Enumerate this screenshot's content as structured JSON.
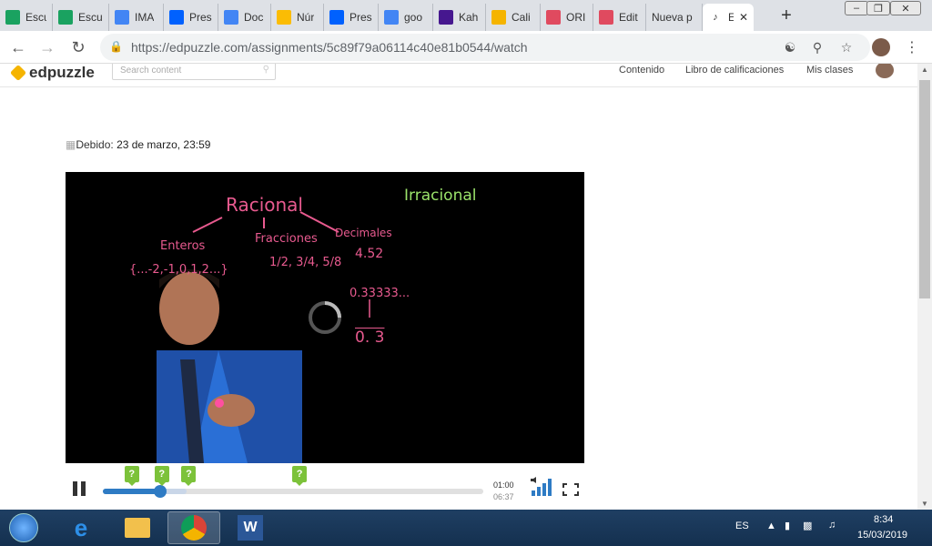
{
  "tabs": [
    {
      "label": "Escu",
      "icon": "kiddle-icon",
      "color": "#1aa260"
    },
    {
      "label": "Escu",
      "icon": "kiddle-icon",
      "color": "#1aa260"
    },
    {
      "label": "IMA",
      "icon": "google-icon",
      "color": "#4285f4"
    },
    {
      "label": "Pres",
      "icon": "dropbox-icon",
      "color": "#0061fe"
    },
    {
      "label": "Doc",
      "icon": "docs-icon",
      "color": "#4285f4"
    },
    {
      "label": "Núr",
      "icon": "drive-icon",
      "color": "#fbbc04"
    },
    {
      "label": "Pres",
      "icon": "dropbox-icon",
      "color": "#0061fe"
    },
    {
      "label": "goo",
      "icon": "google-icon",
      "color": "#4285f4"
    },
    {
      "label": "Kah",
      "icon": "kahoot-icon",
      "color": "#46178f"
    },
    {
      "label": "Cali",
      "icon": "edpuzzle-icon",
      "color": "#f5b400"
    },
    {
      "label": "ORI",
      "icon": "s-icon",
      "color": "#e04a5f"
    },
    {
      "label": "Edit",
      "icon": "s-icon",
      "color": "#e04a5f"
    },
    {
      "label": "Nueva p",
      "icon": "",
      "color": ""
    },
    {
      "label": "E",
      "icon": "audio-icon",
      "color": ""
    }
  ],
  "address": {
    "url": "https://edpuzzle.com/assignments/5c89f79a06114c40e81b0544/watch"
  },
  "site": {
    "logo": "edpuzzle",
    "search_placeholder": "Search content",
    "nav": [
      "Contenido",
      "Libro de calificaciones",
      "Mis clases"
    ]
  },
  "assignment": {
    "due_label": "Debido:",
    "due_date": "23 de marzo, 23:59"
  },
  "video": {
    "board": {
      "title": "Racional",
      "irrational": "Irracional",
      "enteros": "Enteros",
      "enteros_set": "{...-2,-1,0,1,2...}",
      "fracciones": "Fracciones",
      "fracciones_vals": "1/2, 3/4, 5/8",
      "decimales": "Decimales",
      "decimal_example": "4.52",
      "repeating": "0.33333...",
      "repeating_bar": "0. 3"
    },
    "current_time": "01:00",
    "duration": "06:37",
    "progress": 0.151,
    "buffered": 0.22,
    "questions": [
      {
        "label": "?",
        "at": 0.076
      },
      {
        "label": "?",
        "at": 0.155
      },
      {
        "label": "?",
        "at": 0.226
      },
      {
        "label": "?",
        "at": 0.517
      }
    ]
  },
  "taskbar": {
    "lang": "ES",
    "time": "8:34",
    "date": "15/03/2019",
    "apps": [
      "start-orb-icon",
      "ie-icon",
      "explorer-icon",
      "chrome-icon",
      "word-icon"
    ]
  },
  "colors": {
    "accent": "#2e7bc4",
    "question": "#7cc23a",
    "chalk_pink": "#e85a8f",
    "chalk_green": "#9be36b"
  }
}
